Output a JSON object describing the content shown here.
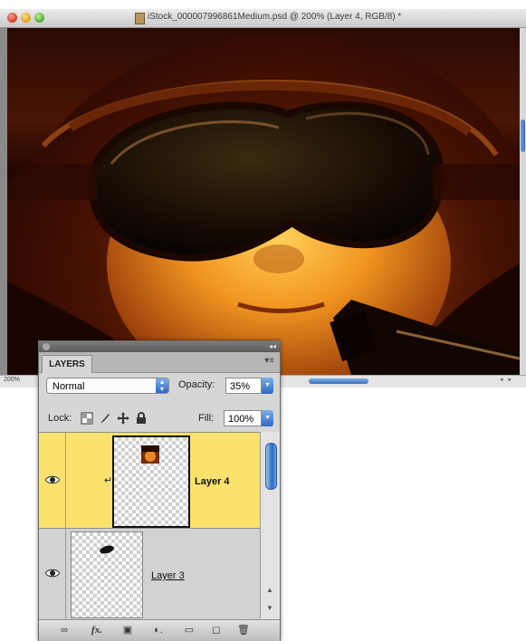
{
  "window": {
    "title": "iStock_000007996861Medium.psd @ 200% (Layer 4, RGB/8) *",
    "zoom": "200%"
  },
  "panel": {
    "tab": "LAYERS",
    "blend_mode": "Normal",
    "opacity_label": "Opacity:",
    "opacity_value": "35%",
    "lock_label": "Lock:",
    "fill_label": "Fill:",
    "fill_value": "100%",
    "layers": [
      {
        "name": "Layer 4",
        "selected": true,
        "clipped": true,
        "visible": true
      },
      {
        "name": "Layer 3",
        "selected": false,
        "clipped": false,
        "visible": true
      }
    ],
    "footer_icons": [
      "link-icon",
      "fx-icon",
      "mask-icon",
      "adjustment-icon",
      "group-icon",
      "new-layer-icon",
      "trash-icon"
    ]
  },
  "colors": {
    "selected_layer": "#fbe26d",
    "accent": "#2f68c3"
  }
}
